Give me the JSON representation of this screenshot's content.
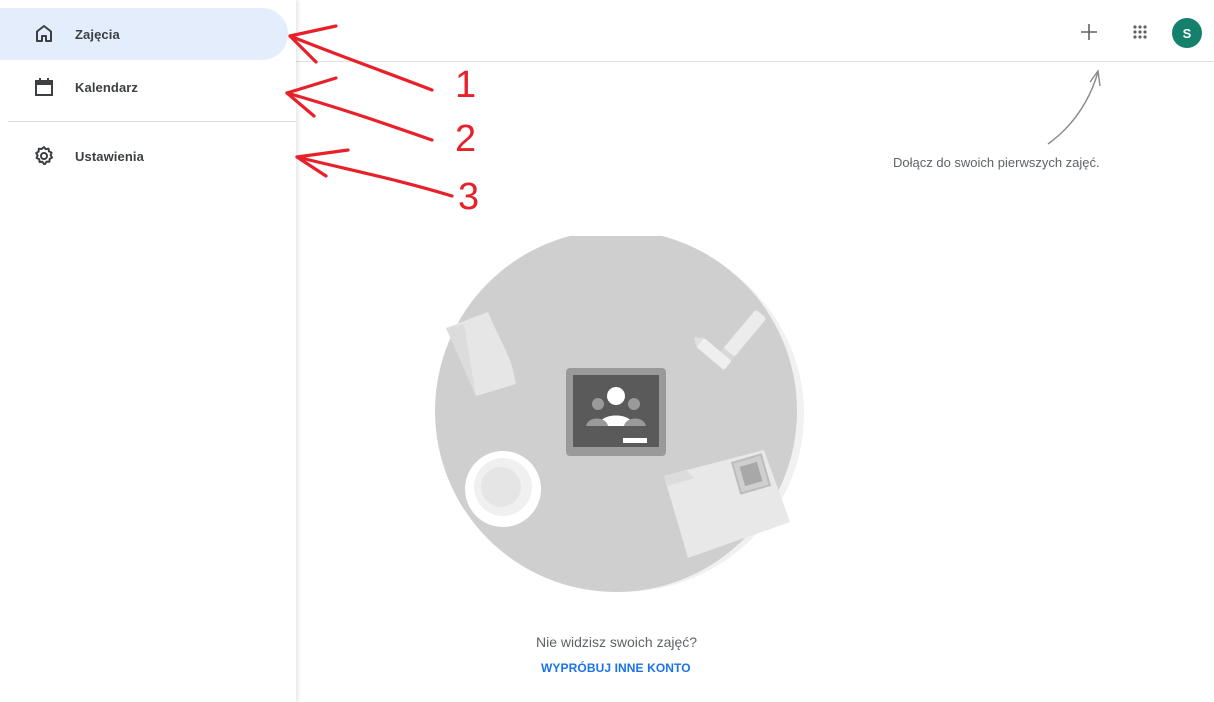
{
  "sidebar": {
    "items": [
      {
        "label": "Zajęcia",
        "icon": "home-icon",
        "active": true
      },
      {
        "label": "Kalendarz",
        "icon": "calendar-icon",
        "active": false
      },
      {
        "label": "Ustawienia",
        "icon": "settings-gear-icon",
        "active": false
      }
    ]
  },
  "header": {
    "add_icon": "plus-icon",
    "apps_icon": "apps-grid-icon",
    "avatar_initial": "S"
  },
  "main": {
    "hint": "Dołącz do swoich pierwszych zajęć.",
    "empty_message": "Nie widzisz swoich zajęć?",
    "try_other_account": "WYPRÓBUJ INNE KONTO"
  },
  "annotations": {
    "numbers": [
      "1",
      "2",
      "3"
    ],
    "color": "#e8202a"
  },
  "colors": {
    "active_nav_bg": "#e3edfb",
    "avatar_bg": "#15806b",
    "link": "#1a73e8"
  }
}
